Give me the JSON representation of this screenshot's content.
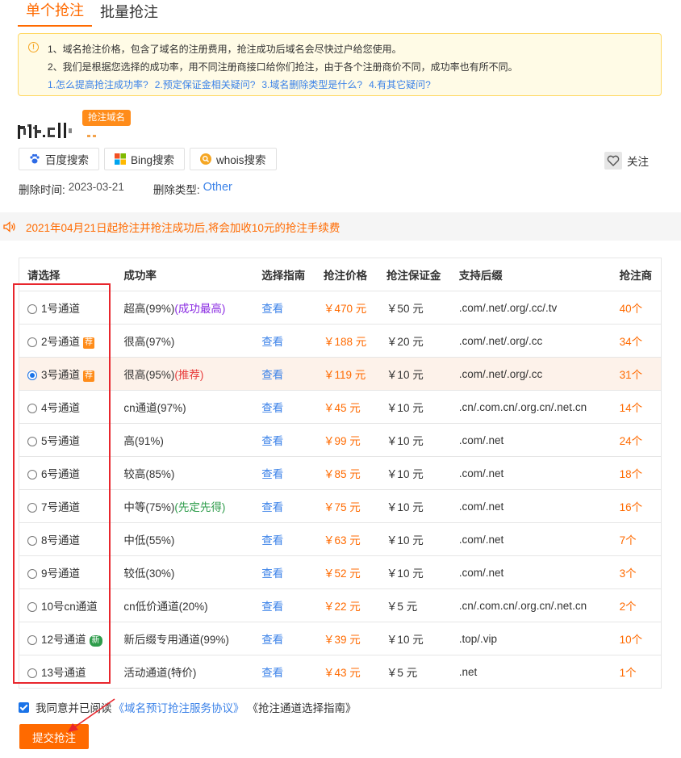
{
  "tabs": [
    {
      "label": "单个抢注"
    },
    {
      "label": "批量抢注"
    }
  ],
  "notice": {
    "line1": "1、域名抢注价格，包含了域名的注册费用，抢注成功后域名会尽快过户给您使用。",
    "line2": "2、我们是根据您选择的成功率，用不同注册商接口给你们抢注，由于各个注册商价不同，成功率也有所不同。",
    "links": [
      "1.怎么提高抢注成功率?",
      "2.预定保证金相关疑问?",
      "3.域名删除类型是什么?",
      "4.有其它疑问?"
    ]
  },
  "domain": {
    "tag": "抢注域名"
  },
  "search_buttons": [
    {
      "label": "百度搜索",
      "icon": "baidu-paw-icon"
    },
    {
      "label": "Bing搜索",
      "icon": "windows-icon"
    },
    {
      "label": "whois搜索",
      "icon": "whois-search-icon"
    }
  ],
  "follow_label": "关注",
  "meta": {
    "delete_time_label": "删除时间:",
    "delete_time": "2023-03-21",
    "delete_type_label": "删除类型:",
    "delete_type": "Other"
  },
  "fee_notice": "2021年04月21日起抢注并抢注成功后,将会加收10元的抢注手续费",
  "table": {
    "headers": [
      "请选择",
      "成功率",
      "选择指南",
      "抢注价格",
      "抢注保证金",
      "支持后缀",
      "抢注商"
    ],
    "rows": [
      {
        "channel": "1号通道",
        "badge": "",
        "rate": "超高(99%)",
        "note": "(成功最高)",
        "note_color": "purple",
        "guide": "查看",
        "price": "￥470 元",
        "deposit": "￥50 元",
        "suffix": ".com/.net/.org/.cc/.tv",
        "registrars": "40个",
        "selected": false
      },
      {
        "channel": "2号通道",
        "badge": "荐",
        "rate": "很高(97%)",
        "note": "",
        "note_color": "",
        "guide": "查看",
        "price": "￥188 元",
        "deposit": "￥20 元",
        "suffix": ".com/.net/.org/.cc",
        "registrars": "34个",
        "selected": false
      },
      {
        "channel": "3号通道",
        "badge": "荐",
        "rate": "很高(95%)",
        "note": "(推荐)",
        "note_color": "red",
        "guide": "查看",
        "price": "￥119 元",
        "deposit": "￥10 元",
        "suffix": ".com/.net/.org/.cc",
        "registrars": "31个",
        "selected": true
      },
      {
        "channel": "4号通道",
        "badge": "",
        "rate": "cn通道(97%)",
        "note": "",
        "note_color": "",
        "guide": "查看",
        "price": "￥45 元",
        "deposit": "￥10 元",
        "suffix": ".cn/.com.cn/.org.cn/.net.cn",
        "registrars": "14个",
        "selected": false
      },
      {
        "channel": "5号通道",
        "badge": "",
        "rate": "高(91%)",
        "note": "",
        "note_color": "",
        "guide": "查看",
        "price": "￥99 元",
        "deposit": "￥10 元",
        "suffix": ".com/.net",
        "registrars": "24个",
        "selected": false
      },
      {
        "channel": "6号通道",
        "badge": "",
        "rate": "较高(85%)",
        "note": "",
        "note_color": "",
        "guide": "查看",
        "price": "￥85 元",
        "deposit": "￥10 元",
        "suffix": ".com/.net",
        "registrars": "18个",
        "selected": false
      },
      {
        "channel": "7号通道",
        "badge": "",
        "rate": "中等(75%)",
        "note": "(先定先得)",
        "note_color": "green",
        "guide": "查看",
        "price": "￥75 元",
        "deposit": "￥10 元",
        "suffix": ".com/.net",
        "registrars": "16个",
        "selected": false
      },
      {
        "channel": "8号通道",
        "badge": "",
        "rate": "中低(55%)",
        "note": "",
        "note_color": "",
        "guide": "查看",
        "price": "￥63 元",
        "deposit": "￥10 元",
        "suffix": ".com/.net",
        "registrars": "7个",
        "selected": false
      },
      {
        "channel": "9号通道",
        "badge": "",
        "rate": "较低(30%)",
        "note": "",
        "note_color": "",
        "guide": "查看",
        "price": "￥52 元",
        "deposit": "￥10 元",
        "suffix": ".com/.net",
        "registrars": "3个",
        "selected": false
      },
      {
        "channel": "10号cn通道",
        "badge": "",
        "rate": "cn低价通道(20%)",
        "note": "",
        "note_color": "",
        "guide": "查看",
        "price": "￥22 元",
        "deposit": "￥5 元",
        "suffix": ".cn/.com.cn/.org.cn/.net.cn",
        "registrars": "2个",
        "selected": false
      },
      {
        "channel": "12号通道",
        "badge": "新",
        "rate": "新后缀专用通道(99%)",
        "note": "",
        "note_color": "",
        "guide": "查看",
        "price": "￥39 元",
        "deposit": "￥10 元",
        "suffix": ".top/.vip",
        "registrars": "10个",
        "selected": false
      },
      {
        "channel": "13号通道",
        "badge": "",
        "rate": "活动通道(特价)",
        "note": "",
        "note_color": "",
        "guide": "查看",
        "price": "￥43 元",
        "deposit": "￥5 元",
        "suffix": ".net",
        "registrars": "1个",
        "selected": false
      }
    ]
  },
  "agreement": {
    "prefix": "我同意并已阅读",
    "link": "《域名预订抢注服务协议》",
    "plain": "《抢注通道选择指南》"
  },
  "submit_label": "提交抢注",
  "colors": {
    "accent": "#ff6a00",
    "link": "#3b82e8",
    "annotation_red": "#e8262d"
  }
}
